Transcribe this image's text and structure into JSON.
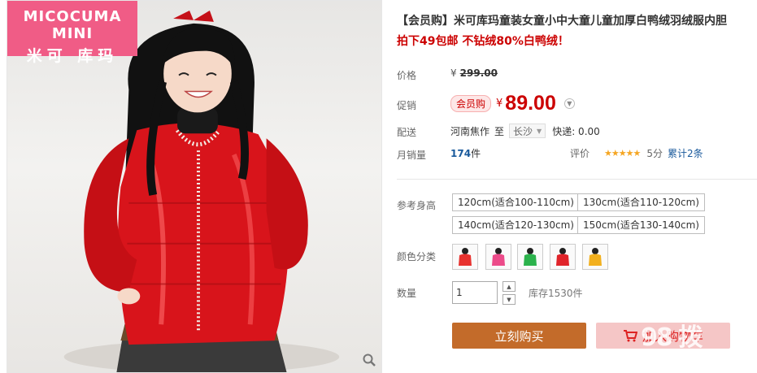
{
  "brand": {
    "line1": "MICOCUMA MINI",
    "line2": "米可 库玛"
  },
  "product": {
    "title": "【会员购】米可库玛童装女童小中大童儿童加厚白鸭绒羽绒服内胆",
    "promo": "拍下49包邮 不钻绒80%白鸭绒！"
  },
  "price": {
    "label": "价格",
    "currency": "¥",
    "original": "299.00"
  },
  "promotion": {
    "label": "促销",
    "badge": "会员购",
    "currency": "¥",
    "value": "89.00"
  },
  "shipping": {
    "label": "配送",
    "origin": "河南焦作",
    "to": "至",
    "destination": "长沙",
    "fee": "快递: 0.00"
  },
  "sales": {
    "label": "月销量",
    "count": "174",
    "unit": "件",
    "rating_label": "评价",
    "stars": "★★★★★",
    "score": "5分",
    "reviews": "累计2条"
  },
  "height": {
    "label": "参考身高",
    "options": [
      "120cm(适合100-110cm)",
      "130cm(适合110-120cm)",
      "140cm(适合120-130cm)",
      "150cm(适合130-140cm)"
    ]
  },
  "color": {
    "label": "颜色分类",
    "swatches": [
      "#e8322f",
      "#ec4b8a",
      "#2bb24c",
      "#e0242a",
      "#f2b01e"
    ]
  },
  "quantity": {
    "label": "数量",
    "value": "1",
    "stock": "库存1530件"
  },
  "actions": {
    "buy": "立刻购买",
    "cart": "加入购物车"
  },
  "watermark": "98 拨",
  "colors": {
    "accent_red": "#cc0000",
    "buy_button": "#c36b2a",
    "cart_button": "#f5c6c6",
    "brand_pink": "#f05c86"
  }
}
